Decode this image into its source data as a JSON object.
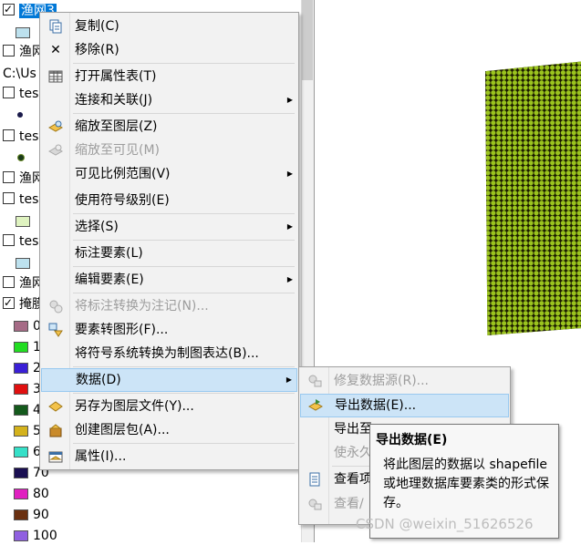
{
  "toc": {
    "rows": [
      {
        "check": true,
        "label": "渔网3",
        "selected": true
      },
      {
        "check": false,
        "label": "渔网"
      },
      {
        "check": null,
        "label": "C:\\Us"
      },
      {
        "check": false,
        "label": "tes"
      },
      {
        "check": false,
        "label": "tes"
      },
      {
        "check": false,
        "label": "渔网"
      },
      {
        "check": false,
        "label": "tes"
      },
      {
        "check": false,
        "label": "tes"
      },
      {
        "check": false,
        "label": "渔网"
      },
      {
        "check": true,
        "label": "掩膜"
      }
    ],
    "legend": [
      {
        "label": "0",
        "color": "#a66b86"
      },
      {
        "label": "1",
        "color": "#22dd22"
      },
      {
        "label": "2",
        "color": "#3a1fd6"
      },
      {
        "label": "3",
        "color": "#e01010"
      },
      {
        "label": "4",
        "color": "#145a1c"
      },
      {
        "label": "5",
        "color": "#d4b21c"
      },
      {
        "label": "6",
        "color": "#36e0c8"
      },
      {
        "label": "70",
        "color": "#1a0f52"
      },
      {
        "label": "80",
        "color": "#e020c0"
      },
      {
        "label": "90",
        "color": "#6a3010"
      },
      {
        "label": "100",
        "color": "#9060e0"
      }
    ]
  },
  "context_menu": {
    "items": [
      {
        "label": "复制(C)",
        "icon": "copy-icon",
        "disabled": false,
        "submenu": false
      },
      {
        "label": "移除(R)",
        "icon": "remove-x-icon",
        "disabled": false,
        "submenu": false
      },
      {
        "label": "打开属性表(T)",
        "icon": "table-icon",
        "disabled": false,
        "submenu": false
      },
      {
        "label": "连接和关联(J)",
        "icon": "",
        "disabled": false,
        "submenu": true
      },
      {
        "label": "缩放至图层(Z)",
        "icon": "zoom-layer-icon",
        "disabled": false,
        "submenu": false
      },
      {
        "label": "缩放至可见(M)",
        "icon": "zoom-visible-icon",
        "disabled": true,
        "submenu": false
      },
      {
        "label": "可见比例范围(V)",
        "icon": "",
        "disabled": false,
        "submenu": true
      },
      {
        "label": "使用符号级别(E)",
        "icon": "",
        "disabled": false,
        "submenu": false
      },
      {
        "label": "选择(S)",
        "icon": "",
        "disabled": false,
        "submenu": true
      },
      {
        "label": "标注要素(L)",
        "icon": "",
        "disabled": false,
        "submenu": false
      },
      {
        "label": "编辑要素(E)",
        "icon": "",
        "disabled": false,
        "submenu": true
      },
      {
        "label": "将标注转换为注记(N)...",
        "icon": "convert-annotation-icon",
        "disabled": true,
        "submenu": false
      },
      {
        "label": "要素转图形(F)...",
        "icon": "feature-graphics-icon",
        "disabled": false,
        "submenu": false
      },
      {
        "label": "将符号系统转换为制图表达(B)...",
        "icon": "",
        "disabled": false,
        "submenu": false
      },
      {
        "label": "数据(D)",
        "icon": "",
        "disabled": false,
        "submenu": true,
        "highlighted": true
      },
      {
        "label": "另存为图层文件(Y)...",
        "icon": "layer-file-icon",
        "disabled": false,
        "submenu": false
      },
      {
        "label": "创建图层包(A)...",
        "icon": "layer-package-icon",
        "disabled": false,
        "submenu": false
      },
      {
        "label": "属性(I)...",
        "icon": "properties-icon",
        "disabled": false,
        "submenu": false
      }
    ]
  },
  "data_submenu": {
    "items": [
      {
        "label": "修复数据源(R)...",
        "icon": "repair-source-icon",
        "disabled": true
      },
      {
        "label": "导出数据(E)...",
        "icon": "export-data-icon",
        "disabled": false,
        "highlighted": true
      },
      {
        "label": "导出至",
        "icon": "",
        "disabled": false
      },
      {
        "label": "使永久",
        "icon": "",
        "disabled": true
      },
      {
        "label": "查看项",
        "icon": "view-item-icon",
        "disabled": false
      },
      {
        "label": "查看/",
        "icon": "view-icon",
        "disabled": true
      }
    ]
  },
  "tooltip": {
    "title": "导出数据(E)",
    "body": "将此图层的数据以 shapefile 或地理数据库要素类的形式保存。"
  },
  "watermark": "CSDN @weixin_51626526",
  "colors": {
    "selection_bg": "#cce4f7",
    "selection_border": "#99c9ef",
    "toc_selected": "#0078d7",
    "grid_point": "#9bc41e"
  }
}
